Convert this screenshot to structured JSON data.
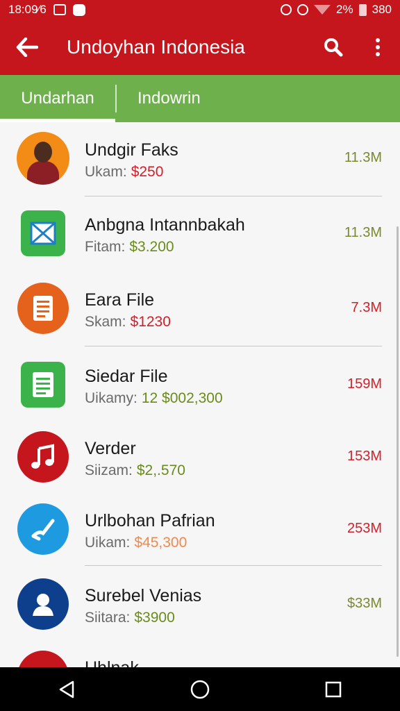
{
  "status_bar": {
    "time": "18:09⁄6",
    "battery_pct": "2%",
    "right_value": "380"
  },
  "app_bar": {
    "title": "Undoyhan Indonesia",
    "back_icon": "arrow-left-icon",
    "search_icon": "search-icon",
    "menu_icon": "more-vert-icon"
  },
  "tabs": [
    {
      "label": "Undarhan",
      "active": true
    },
    {
      "label": "Indowrin",
      "active": false
    }
  ],
  "items": [
    {
      "name": "Undgir Faks",
      "sub_label": "Ukam:",
      "price": "$250",
      "price_color": "#d0212b",
      "size": "11.3M",
      "size_color": "#7a8a2a",
      "icon": "avatar-photo"
    },
    {
      "name": "Anbgna Intannbakah",
      "sub_label": "Fitam:",
      "price": "$3.200",
      "price_color": "#6b8a1e",
      "size": "11.3M",
      "size_color": "#7a8a2a",
      "icon": "mail-icon"
    },
    {
      "name": "Eara File",
      "sub_label": "Skam:",
      "price": "$1230",
      "price_color": "#d0212b",
      "size": "7.3M",
      "size_color": "#d0212b",
      "icon": "document-icon"
    },
    {
      "name": "Siedar File",
      "sub_label": "Uikamy:",
      "price": "12  $002,300",
      "price_color": "#6b8a1e",
      "size": "159M",
      "size_color": "#d0212b",
      "icon": "spreadsheet-icon"
    },
    {
      "name": "Verder",
      "sub_label": "Siizam:",
      "price": "$2,.570",
      "price_color": "#6b8a1e",
      "size": "153M",
      "size_color": "#d0212b",
      "icon": "music-note-icon"
    },
    {
      "name": "Urlbohan Pafrian",
      "sub_label": "Uikam:",
      "price": "$45,300",
      "price_color": "#ef8a4e",
      "size": "253M",
      "size_color": "#d0212b",
      "icon": "paint-icon"
    },
    {
      "name": "Surebel Venias",
      "sub_label": "Siitara:",
      "price": "$3900",
      "price_color": "#6b8a1e",
      "size": "$33M",
      "size_color": "#7a8a2a",
      "icon": "person-icon"
    },
    {
      "name": "Uhlnak",
      "sub_label": "",
      "price": "",
      "price_color": "#6b8a1e",
      "size": "",
      "size_color": "#7a8a2a",
      "icon": "home-icon"
    }
  ],
  "colors": {
    "app_bar": "#c4161c",
    "tab_bar": "#6db04c"
  }
}
